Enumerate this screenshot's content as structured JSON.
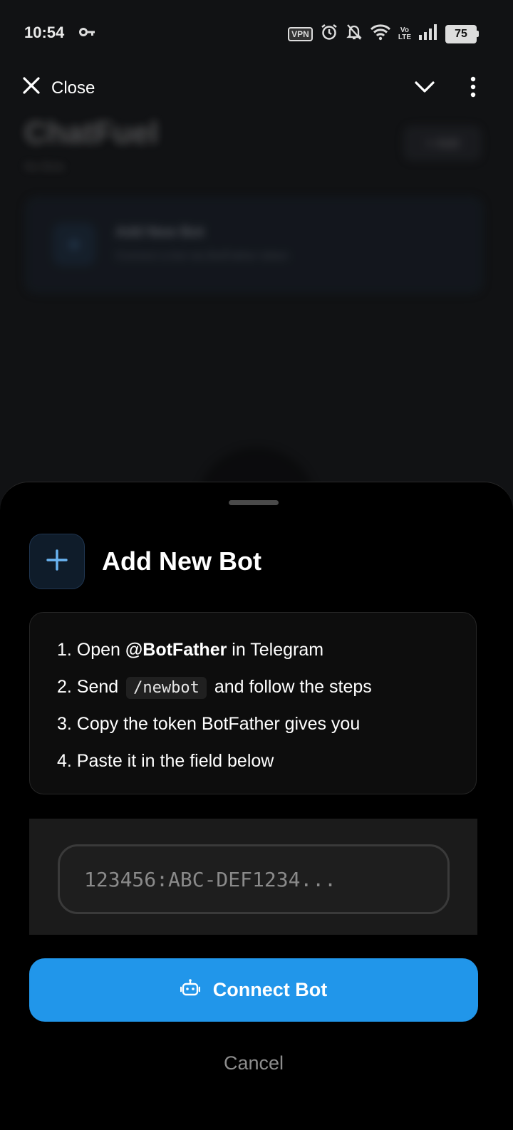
{
  "status_bar": {
    "time": "10:54",
    "vpn_label": "VPN",
    "volte_label_top": "Vo",
    "volte_label_bottom": "LTE",
    "battery_level": "75"
  },
  "top_bar": {
    "close_label": "Close",
    "icons": [
      "close-icon",
      "chevron-down-icon",
      "more-vert-icon"
    ]
  },
  "background": {
    "title": "ChatFuel",
    "subtitle": "No Bots",
    "action_label": "+ Add",
    "card_title": "Add New Bot",
    "card_desc": "Connect a bot via BotFather token"
  },
  "sheet": {
    "title": "Add New Bot",
    "steps": {
      "s1_prefix": "1. Open",
      "s1_bold": "@BotFather",
      "s1_suffix": "in Telegram",
      "s2_prefix": "2. Send",
      "s2_code": "/newbot",
      "s2_suffix": "and follow the steps",
      "s3": "3. Copy the token BotFather gives you",
      "s4": "4. Paste it in the field below"
    },
    "token_input": {
      "value": "",
      "placeholder": "123456:ABC-DEF1234..."
    },
    "connect_label": "Connect Bot",
    "cancel_label": "Cancel"
  },
  "colors": {
    "accent": "#2196ea",
    "sheet_bg": "#000000",
    "card_bg": "#0d0d0d",
    "input_area_bg": "#1b1b1b"
  }
}
